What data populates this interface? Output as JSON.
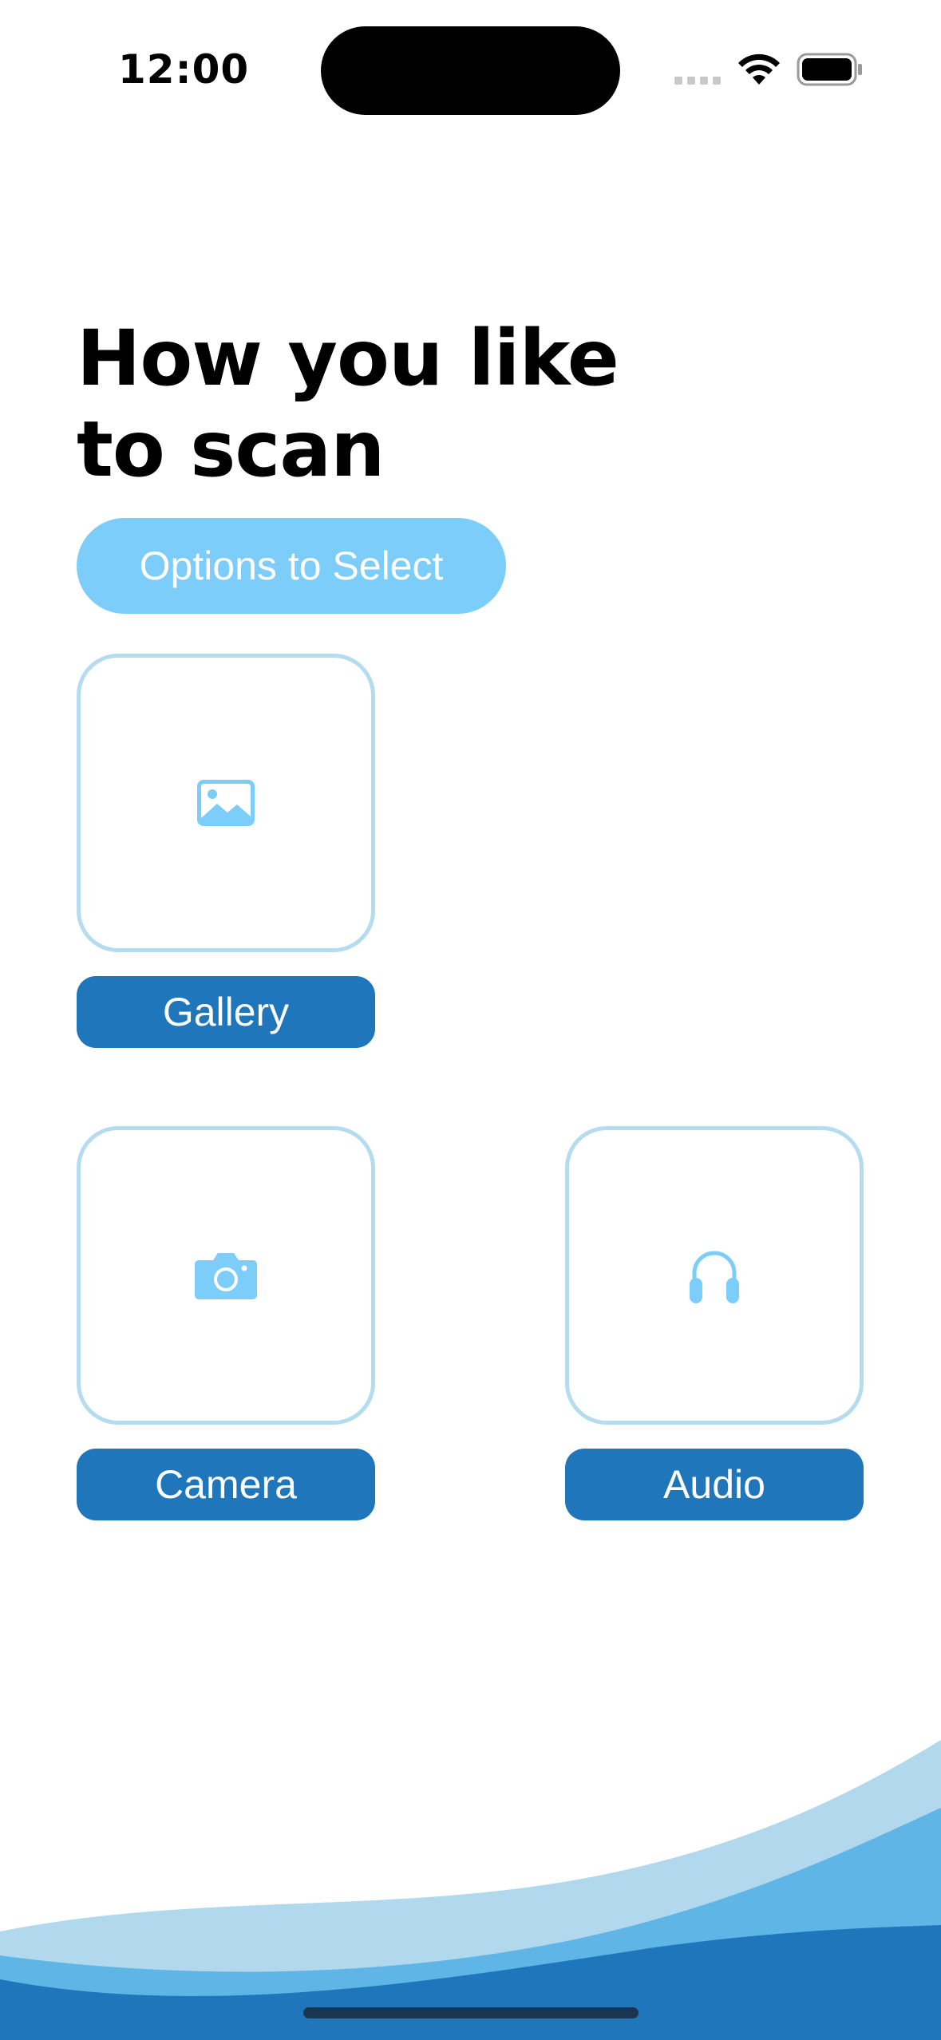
{
  "status_bar": {
    "time": "12:00",
    "wifi_icon": "wifi-icon",
    "battery_icon": "battery-icon"
  },
  "header": {
    "title_line1": "How you like",
    "title_line2": "to scan"
  },
  "options_label": "Options to Select",
  "options": [
    {
      "label": "Gallery",
      "icon": "photo-icon"
    },
    {
      "label": "Camera",
      "icon": "camera-icon"
    },
    {
      "label": "Audio",
      "icon": "headphones-icon"
    }
  ],
  "colors": {
    "accent_light": "#7dcdfa",
    "accent_dark": "#1f76bb",
    "card_border": "#b3dcee"
  }
}
